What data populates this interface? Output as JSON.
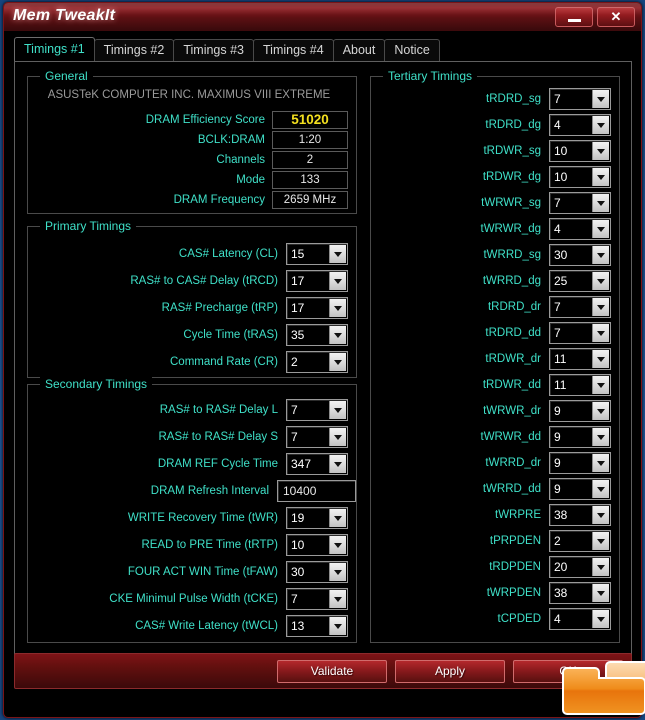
{
  "window": {
    "title": "Mem TweakIt",
    "minimize_label": "—",
    "close_label": "✕"
  },
  "tabs": [
    {
      "label": "Timings #1",
      "active": true
    },
    {
      "label": "Timings #2",
      "active": false
    },
    {
      "label": "Timings #3",
      "active": false
    },
    {
      "label": "Timings #4",
      "active": false
    },
    {
      "label": "About",
      "active": false
    },
    {
      "label": "Notice",
      "active": false
    }
  ],
  "general": {
    "legend": "General",
    "motherboard": "ASUSTeK COMPUTER INC. MAXIMUS VIII EXTREME",
    "highlight_color": "#f4e01f",
    "rows": [
      {
        "label": "DRAM Efficiency Score",
        "value": "51020",
        "highlight": true
      },
      {
        "label": "BCLK:DRAM",
        "value": "1:20",
        "highlight": false
      },
      {
        "label": "Channels",
        "value": "2",
        "highlight": false
      },
      {
        "label": "Mode",
        "value": "133",
        "highlight": false
      },
      {
        "label": "DRAM Frequency",
        "value": "2659 MHz",
        "highlight": false
      }
    ]
  },
  "primary": {
    "legend": "Primary Timings",
    "rows": [
      {
        "label": "CAS# Latency (CL)",
        "value": "15"
      },
      {
        "label": "RAS# to CAS# Delay (tRCD)",
        "value": "17"
      },
      {
        "label": "RAS# Precharge (tRP)",
        "value": "17"
      },
      {
        "label": "Cycle Time (tRAS)",
        "value": "35"
      },
      {
        "label": "Command Rate (CR)",
        "value": "2"
      }
    ]
  },
  "secondary": {
    "legend": "Secondary Timings",
    "rows": [
      {
        "label": "RAS# to RAS# Delay L",
        "value": "7",
        "type": "combo"
      },
      {
        "label": "RAS# to RAS# Delay S",
        "value": "7",
        "type": "combo"
      },
      {
        "label": "DRAM REF Cycle Time",
        "value": "347",
        "type": "combo"
      },
      {
        "label": "DRAM Refresh Interval",
        "value": "10400",
        "type": "text"
      },
      {
        "label": "WRITE Recovery Time (tWR)",
        "value": "19",
        "type": "combo"
      },
      {
        "label": "READ to PRE Time (tRTP)",
        "value": "10",
        "type": "combo"
      },
      {
        "label": "FOUR ACT WIN Time (tFAW)",
        "value": "30",
        "type": "combo"
      },
      {
        "label": "CKE Minimul Pulse Width (tCKE)",
        "value": "7",
        "type": "combo"
      },
      {
        "label": "CAS# Write Latency (tWCL)",
        "value": "13",
        "type": "combo"
      }
    ]
  },
  "tertiary": {
    "legend": "Tertiary Timings",
    "rows": [
      {
        "label": "tRDRD_sg",
        "value": "7"
      },
      {
        "label": "tRDRD_dg",
        "value": "4"
      },
      {
        "label": "tRDWR_sg",
        "value": "10"
      },
      {
        "label": "tRDWR_dg",
        "value": "10"
      },
      {
        "label": "tWRWR_sg",
        "value": "7"
      },
      {
        "label": "tWRWR_dg",
        "value": "4"
      },
      {
        "label": "tWRRD_sg",
        "value": "30"
      },
      {
        "label": "tWRRD_dg",
        "value": "25"
      },
      {
        "label": "tRDRD_dr",
        "value": "7"
      },
      {
        "label": "tRDRD_dd",
        "value": "7"
      },
      {
        "label": "tRDWR_dr",
        "value": "11"
      },
      {
        "label": "tRDWR_dd",
        "value": "11"
      },
      {
        "label": "tWRWR_dr",
        "value": "9"
      },
      {
        "label": "tWRWR_dd",
        "value": "9"
      },
      {
        "label": "tWRRD_dr",
        "value": "9"
      },
      {
        "label": "tWRRD_dd",
        "value": "9"
      },
      {
        "label": "tWRPRE",
        "value": "38"
      },
      {
        "label": "tPRPDEN",
        "value": "2"
      },
      {
        "label": "tRDPDEN",
        "value": "20"
      },
      {
        "label": "tWRPDEN",
        "value": "38"
      },
      {
        "label": "tCPDED",
        "value": "4"
      }
    ]
  },
  "footer": {
    "validate_label": "Validate",
    "apply_label": "Apply",
    "ok_label": "OK"
  },
  "theme": {
    "accent_teal": "#3fe0c8",
    "accent_red": "#8e1a1f",
    "folder_orange": "#e8740c"
  }
}
